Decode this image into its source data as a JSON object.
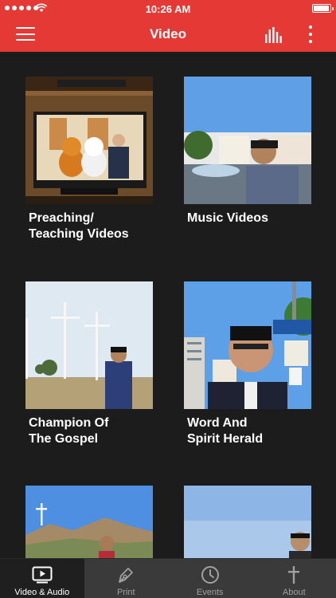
{
  "status_bar": {
    "time": "10:26 AM"
  },
  "header": {
    "title": "Video"
  },
  "icons": {
    "menu": "hamburger-menu-icon",
    "audio": "equalizer-icon",
    "more": "more-vertical-icon"
  },
  "colors": {
    "accent": "#e53935",
    "background": "#1c1c1c",
    "tabbar": "#3a3a3a"
  },
  "videos": [
    {
      "title": "Preaching/\nTeaching Videos",
      "thumbnail": "tv-screen-plush-toys-preacher"
    },
    {
      "title": "Music Videos",
      "thumbnail": "man-by-fountain"
    },
    {
      "title": "Champion Of\nThe Gospel",
      "thumbnail": "man-with-white-crosses"
    },
    {
      "title": "Word And\nSpirit Herald",
      "thumbnail": "man-by-azusa-street-sign"
    },
    {
      "title": "",
      "thumbnail": "man-on-hill-with-cross"
    },
    {
      "title": "",
      "thumbnail": "man-under-sky"
    }
  ],
  "tabs": [
    {
      "label": "Video & Audio",
      "icon": "video-player-icon",
      "active": true
    },
    {
      "label": "Print",
      "icon": "pen-nib-icon",
      "active": false
    },
    {
      "label": "Events",
      "icon": "clock-icon",
      "active": false
    },
    {
      "label": "About",
      "icon": "cross-icon",
      "active": false
    }
  ]
}
